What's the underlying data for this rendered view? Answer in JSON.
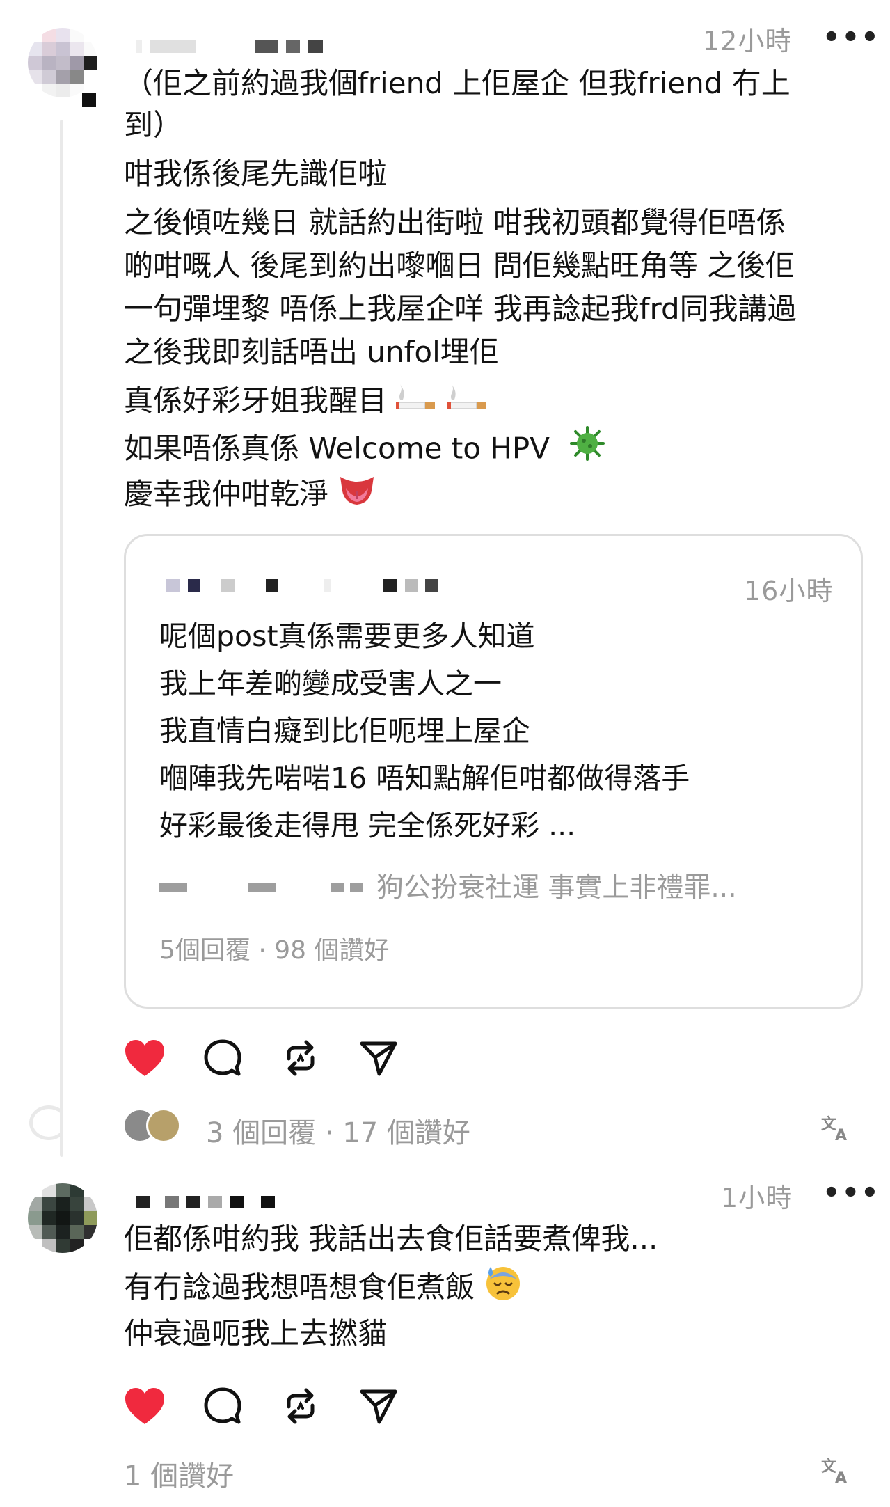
{
  "comments": [
    {
      "time": "12小時",
      "more": "•••",
      "lines": [
        "（佢之前約過我個friend 上佢屋企 但我friend 冇上",
        "到）",
        "咁我係後尾先識佢啦",
        "之後傾咗幾日 就話約出街啦 咁我初頭都覺得佢唔係",
        "啲咁嘅人 後尾到約出嚟嗰日 問佢幾點旺角等 之後佢",
        "一句彈埋黎 唔係上我屋企咩 我再諗起我frd同我講過",
        "之後我即刻話唔出 unfol埋佢",
        "真係好彩牙姐我醒目",
        "如果唔係真係 Welcome to HPV",
        "慶幸我仲咁乾淨"
      ],
      "quote": {
        "time": "16小時",
        "lines": [
          "呢個post真係需要更多人知道",
          "我上年差啲變成受害人之一",
          "我直情白癡到比佢呃埋上屋企",
          "嗰陣我先啱啱16 唔知點解佢咁都做得落手",
          "好彩最後走得甩 完全係死好彩 ..."
        ],
        "sub_reply": "狗公扮衰社運 事實上非禮罪...",
        "stats": "5個回覆 · 98 個讚好"
      },
      "stats": "3 個回覆 · 17 個讚好",
      "translate_icon": "translate-icon"
    },
    {
      "time": "1小時",
      "more": "•••",
      "lines": [
        "佢都係咁約我 我話出去食佢話要煮俾我...",
        "有冇諗過我想唔想食佢煮飯",
        "仲衰過呃我上去撚貓"
      ],
      "stats": "1 個讚好",
      "translate_icon": "translate-icon"
    }
  ],
  "icons": {
    "like": "heart-icon",
    "reply": "comment-bubble-icon",
    "repost": "repost-icon",
    "share": "send-icon"
  },
  "colors": {
    "like_red": "#f0293e",
    "muted": "#9a9a9a",
    "border": "#dedede"
  }
}
